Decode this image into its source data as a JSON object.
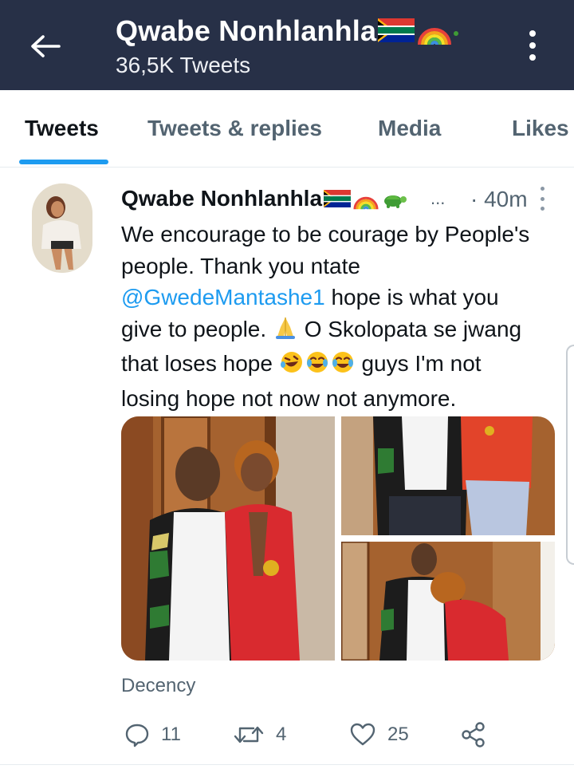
{
  "header": {
    "title": "Qwabe Nonhlanhla",
    "tweet_count": "36,5K Tweets"
  },
  "tabs": [
    {
      "label": "Tweets",
      "active": true
    },
    {
      "label": "Tweets & replies",
      "active": false
    },
    {
      "label": "Media",
      "active": false
    },
    {
      "label": "Likes",
      "active": false
    }
  ],
  "tweet": {
    "author_name": "Qwabe Nonhlanhla",
    "ellipsis": "...",
    "time": "· 40m",
    "text": {
      "line1": "We encourage to be courage by People's",
      "line2": "people. Thank you ntate",
      "mention": "@GwedeMantashe1",
      "line3_rest": " hope is what you",
      "line4_a": "give to people. ",
      "line4_b": " O Skolopata se jwang",
      "line5_a": "that loses hope ",
      "line5_b": " guys I'm not",
      "line6": "losing hope not now not anymore."
    },
    "source": "Decency",
    "stats": {
      "replies": "11",
      "retweets": "4",
      "likes": "25"
    }
  },
  "icons": {
    "back": "arrow-left-icon",
    "overflow": "more-vertical-icon",
    "reply": "reply-icon",
    "retweet": "retweet-icon",
    "like": "heart-icon",
    "share": "share-icon"
  },
  "colors": {
    "header_bg": "#273047",
    "accent": "#1d9bf0",
    "secondary_text": "#536471"
  }
}
